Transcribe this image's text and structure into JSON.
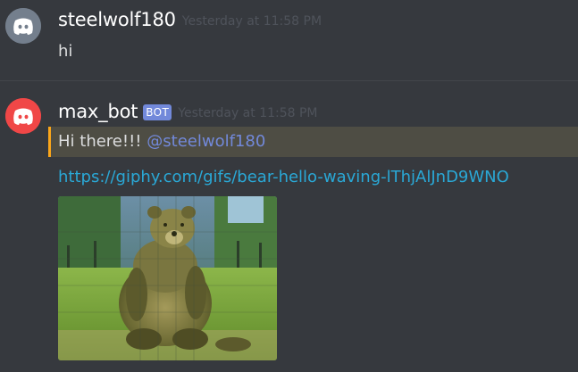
{
  "messages": [
    {
      "username": "steelwolf180",
      "timestamp": "Yesterday at 11:58 PM",
      "text": "hi",
      "avatar_icon": "discord-logo-icon"
    },
    {
      "username": "max_bot",
      "bot_tag": "BOT",
      "timestamp": "Yesterday at 11:58 PM",
      "text": "Hi there!!!",
      "mention": "@steelwolf180",
      "link": "https://giphy.com/gifs/bear-hello-waving-lThjAlJnD9WNO",
      "avatar_icon": "discord-logo-icon",
      "image_alt": "bear-waving-gif"
    }
  ],
  "colors": {
    "background": "#36393e",
    "mention_highlight": "#4e4d44",
    "mention_bar": "#faa61a",
    "link": "#2aa8d6",
    "bot_tag": "#7289da"
  }
}
